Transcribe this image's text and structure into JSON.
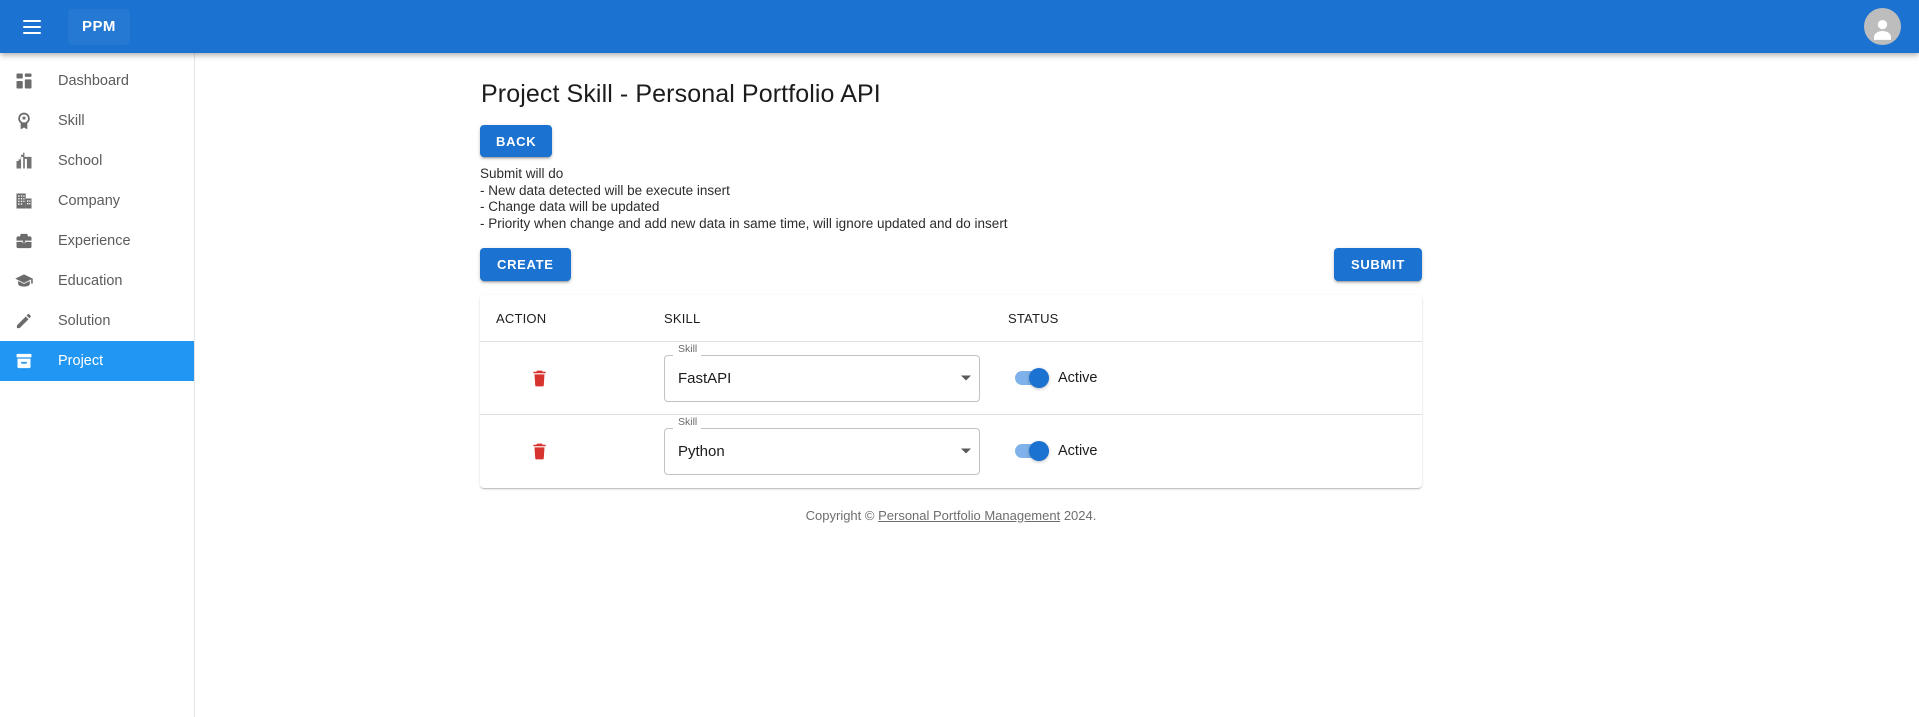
{
  "appbar": {
    "menu_icon": "hamburger-menu-icon",
    "brand": "PPM",
    "avatar_icon": "account-circle-icon",
    "background_color": "#1b72d0"
  },
  "sidebar": {
    "items": [
      {
        "label": "Dashboard",
        "icon": "dashboard-icon",
        "active": false
      },
      {
        "label": "Skill",
        "icon": "award-badge-icon",
        "active": false
      },
      {
        "label": "School",
        "icon": "school-building-icon",
        "active": false
      },
      {
        "label": "Company",
        "icon": "office-building-icon",
        "active": false
      },
      {
        "label": "Experience",
        "icon": "briefcase-icon",
        "active": false
      },
      {
        "label": "Education",
        "icon": "graduation-cap-icon",
        "active": false
      },
      {
        "label": "Solution",
        "icon": "pencil-edit-icon",
        "active": false
      },
      {
        "label": "Project",
        "icon": "archive-box-icon",
        "active": true
      }
    ],
    "active_background_color": "#2196f3"
  },
  "main": {
    "title": "Project Skill - Personal Portfolio API",
    "back_button": "BACK",
    "note": {
      "heading": "Submit will do",
      "lines": [
        "- New data detected will be execute insert",
        "- Change data will be updated",
        "- Priority when change and add new data in same time, will ignore updated and do insert"
      ]
    },
    "create_button": "CREATE",
    "submit_button": "SUBMIT",
    "table": {
      "columns": [
        "ACTION",
        "SKILL",
        "STATUS"
      ],
      "rows": [
        {
          "delete_icon": "trash-delete-icon",
          "skill_label": "Skill",
          "skill_value": "FastAPI",
          "status_on": true,
          "status_label": "Active"
        },
        {
          "delete_icon": "trash-delete-icon",
          "skill_label": "Skill",
          "skill_value": "Python",
          "status_on": true,
          "status_label": "Active"
        }
      ]
    }
  },
  "footer": {
    "prefix": "Copyright © ",
    "link": "Personal Portfolio Management",
    "suffix": " 2024."
  },
  "colors": {
    "primary": "#1b72d0",
    "danger": "#d8342f",
    "switch_track": "#7fb2ea"
  }
}
